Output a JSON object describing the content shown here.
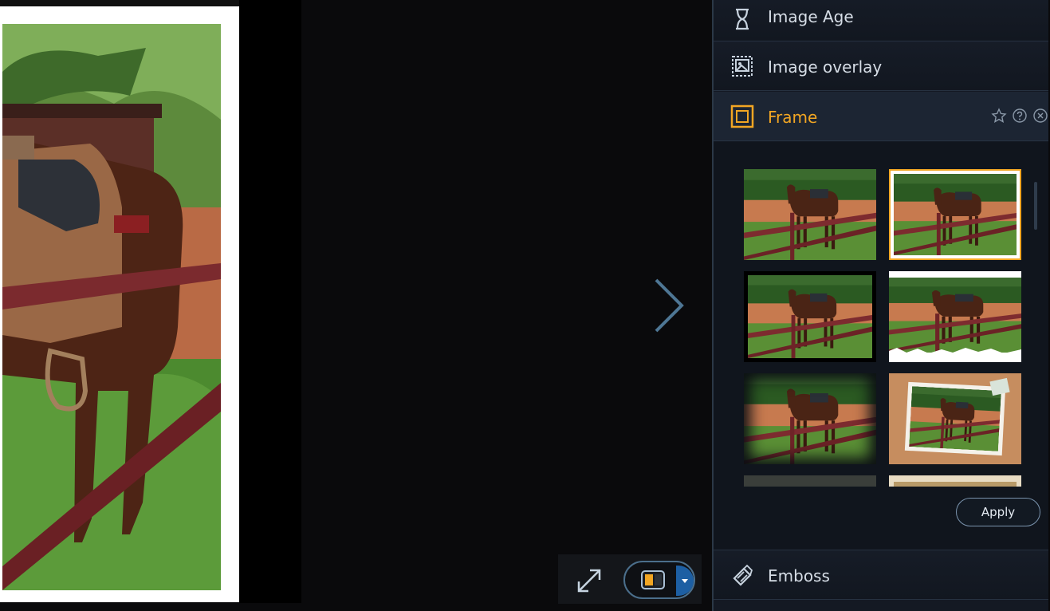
{
  "panel": {
    "items": [
      {
        "label": "Image Age",
        "icon": "hourglass-icon"
      },
      {
        "label": "Image overlay",
        "icon": "image-overlay-icon"
      },
      {
        "label": "Frame",
        "icon": "frame-icon"
      },
      {
        "label": "Emboss",
        "icon": "emboss-icon"
      }
    ],
    "frame": {
      "header_icons": [
        "star-icon",
        "help-icon",
        "close-icon"
      ],
      "thumbnails": [
        {
          "style": "plain",
          "selected": false
        },
        {
          "style": "white-border",
          "selected": true
        },
        {
          "style": "black-border",
          "selected": false
        },
        {
          "style": "torn-edge",
          "selected": false
        },
        {
          "style": "vignette",
          "selected": false
        },
        {
          "style": "postcard",
          "selected": false
        },
        {
          "style": "dark-strip",
          "selected": false
        },
        {
          "style": "cream-strip",
          "selected": false
        }
      ],
      "apply_label": "Apply"
    }
  },
  "viewer": {
    "next_icon": "chevron-right-icon",
    "fit_icon": "expand-icon",
    "compare_icon": "split-view-icon",
    "dropdown_icon": "caret-down-icon"
  },
  "colors": {
    "accent": "#f2a623",
    "panel_bg": "#141923",
    "viewer_bg": "#0a0a0c"
  }
}
